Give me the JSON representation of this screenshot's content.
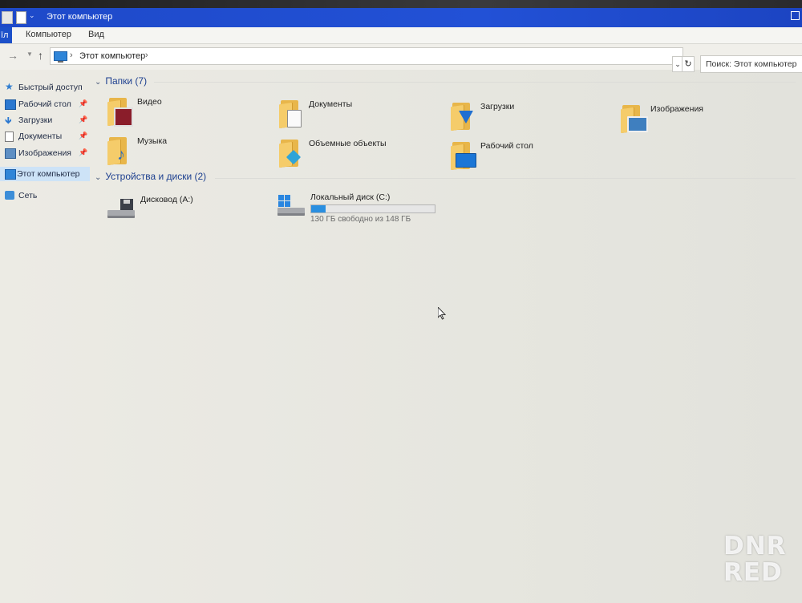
{
  "window": {
    "title": "Этот компьютер"
  },
  "ribbon": {
    "file_tab": "ïл",
    "tabs": [
      "Компьютер",
      "Вид"
    ]
  },
  "navigation": {
    "address_path": "Этот компьютер",
    "search_placeholder": "Поиск: Этот компьютер"
  },
  "sidebar": {
    "items": [
      {
        "label": "Быстрый доступ",
        "icon": "star-icon",
        "pinned": false
      },
      {
        "label": "Рабочий стол",
        "icon": "desktop-icon",
        "pinned": true
      },
      {
        "label": "Загрузки",
        "icon": "download-icon",
        "pinned": true
      },
      {
        "label": "Документы",
        "icon": "documents-icon",
        "pinned": true
      },
      {
        "label": "Изображения",
        "icon": "pictures-icon",
        "pinned": true
      },
      {
        "label": "Этот компьютер",
        "icon": "computer-icon",
        "selected": true
      },
      {
        "label": "Сеть",
        "icon": "network-icon"
      }
    ]
  },
  "folders": {
    "header": "Папки (7)",
    "items": [
      {
        "name": "Видео",
        "icon": "video-folder-icon"
      },
      {
        "name": "Документы",
        "icon": "documents-folder-icon"
      },
      {
        "name": "Загрузки",
        "icon": "downloads-folder-icon"
      },
      {
        "name": "Изображения",
        "icon": "pictures-folder-icon"
      },
      {
        "name": "Музыка",
        "icon": "music-folder-icon"
      },
      {
        "name": "Объемные объекты",
        "icon": "3d-objects-folder-icon"
      },
      {
        "name": "Рабочий стол",
        "icon": "desktop-folder-icon"
      }
    ]
  },
  "devices": {
    "header": "Устройства и диски (2)",
    "items": [
      {
        "name": "Дисковод (A:)",
        "icon": "floppy-drive-icon"
      },
      {
        "name": "Локальный диск (C:)",
        "icon": "local-disk-icon",
        "used_fraction": 0.12,
        "free_text": "130 ГБ свободно из 148 ГБ"
      }
    ]
  },
  "watermark": {
    "line1": "DNR",
    "line2": "RED"
  },
  "colors": {
    "titlebar": "#2251d6",
    "accent": "#2a8fe0",
    "folder": "#f5cc6a"
  }
}
